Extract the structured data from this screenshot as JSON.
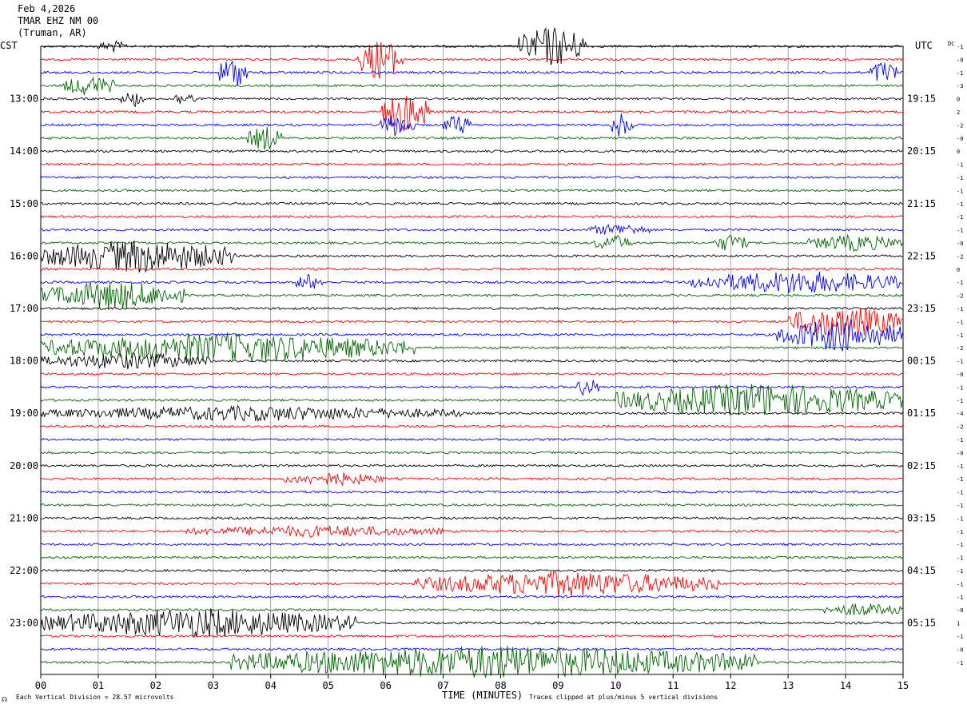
{
  "header": {
    "date": "Feb 4,2026",
    "station": "TMAR EHZ NM 00",
    "location": "(Truman, AR)"
  },
  "axis_labels": {
    "left_tz": "CST",
    "right_tz": "UTC",
    "dc_label": "DC",
    "xlabel": "TIME (MINUTES)"
  },
  "footer": {
    "mark": "☊",
    "scale": "Each Vertical Division =   28.57 microvolts",
    "clip": "Traces clipped at plus/minus 5 vertical divisions"
  },
  "colors": {
    "black": "#000000",
    "red": "#ff0000",
    "blue": "#0000ff",
    "green": "#006400",
    "grid": "#808080"
  },
  "chart_data": {
    "type": "line",
    "title": "TMAR EHZ NM 00 (Truman, AR)",
    "xlabel": "TIME (MINUTES)",
    "xlim": [
      0,
      15
    ],
    "x_ticks": [
      "00",
      "01",
      "02",
      "03",
      "04",
      "05",
      "06",
      "07",
      "08",
      "09",
      "10",
      "11",
      "12",
      "13",
      "14",
      "15"
    ],
    "left_hour_labels": [
      "13:00",
      "14:00",
      "15:00",
      "16:00",
      "17:00",
      "18:00",
      "19:00",
      "20:00",
      "21:00",
      "22:00",
      "23:00"
    ],
    "right_hour_labels": [
      "19:15",
      "20:15",
      "21:15",
      "22:15",
      "23:15",
      "00:15",
      "01:15",
      "02:15",
      "03:15",
      "04:15",
      "05:15"
    ],
    "trace_colors": [
      "black",
      "red",
      "blue",
      "green"
    ],
    "dc_offsets": [
      "-1",
      "-0",
      "-1",
      "-3",
      "0",
      "2",
      "-2",
      "-0",
      "0",
      "-1",
      "-1",
      "-1",
      "-1",
      "-1",
      "-1",
      "-0",
      "-2",
      "0",
      "-1",
      "-2",
      "-1",
      "-1",
      "-1",
      "-2",
      "-1",
      "-0",
      "-1",
      "-1",
      "-4",
      "-2",
      "-1",
      "-0",
      "-1",
      "-1",
      "-1",
      "-1",
      "-1",
      "-1",
      "-1",
      "-1",
      "-1",
      "-1",
      "-1",
      "-0",
      "1",
      "-1",
      "-0",
      "-1"
    ],
    "activity_bursts": [
      {
        "row": 0,
        "start": 8.3,
        "end": 9.5,
        "level": 5
      },
      {
        "row": 0,
        "start": 1.0,
        "end": 1.5,
        "level": 1.5
      },
      {
        "row": 1,
        "start": 5.5,
        "end": 6.3,
        "level": 5
      },
      {
        "row": 2,
        "start": 3.1,
        "end": 3.6,
        "level": 4
      },
      {
        "row": 2,
        "start": 14.4,
        "end": 14.9,
        "level": 3
      },
      {
        "row": 3,
        "start": 0.4,
        "end": 1.3,
        "level": 2.5
      },
      {
        "row": 4,
        "start": 1.4,
        "end": 1.8,
        "level": 2
      },
      {
        "row": 4,
        "start": 2.3,
        "end": 2.7,
        "level": 1.8
      },
      {
        "row": 5,
        "start": 5.9,
        "end": 6.8,
        "level": 5
      },
      {
        "row": 6,
        "start": 5.9,
        "end": 6.5,
        "level": 3
      },
      {
        "row": 6,
        "start": 7.0,
        "end": 7.5,
        "level": 2.5
      },
      {
        "row": 6,
        "start": 9.9,
        "end": 10.3,
        "level": 3
      },
      {
        "row": 7,
        "start": 3.6,
        "end": 4.2,
        "level": 3
      },
      {
        "row": 14,
        "start": 9.5,
        "end": 10.6,
        "level": 1.5
      },
      {
        "row": 15,
        "start": 9.6,
        "end": 10.3,
        "level": 2
      },
      {
        "row": 15,
        "start": 11.7,
        "end": 12.3,
        "level": 2.2
      },
      {
        "row": 15,
        "start": 13.3,
        "end": 15.0,
        "level": 2
      },
      {
        "row": 16,
        "start": 0.0,
        "end": 3.4,
        "level": 4
      },
      {
        "row": 18,
        "start": 4.4,
        "end": 4.9,
        "level": 2
      },
      {
        "row": 18,
        "start": 11.3,
        "end": 15.0,
        "level": 2.8
      },
      {
        "row": 19,
        "start": 0.0,
        "end": 2.5,
        "level": 3.5
      },
      {
        "row": 21,
        "start": 13.0,
        "end": 15.0,
        "level": 4
      },
      {
        "row": 22,
        "start": 12.8,
        "end": 15.0,
        "level": 4
      },
      {
        "row": 23,
        "start": 0.0,
        "end": 6.5,
        "level": 3.5
      },
      {
        "row": 24,
        "start": 0.0,
        "end": 3.0,
        "level": 2
      },
      {
        "row": 26,
        "start": 9.3,
        "end": 9.7,
        "level": 2.5
      },
      {
        "row": 27,
        "start": 10.0,
        "end": 15.0,
        "level": 4
      },
      {
        "row": 28,
        "start": 0.0,
        "end": 7.3,
        "level": 1.8
      },
      {
        "row": 33,
        "start": 4.2,
        "end": 6.0,
        "level": 1.6
      },
      {
        "row": 37,
        "start": 2.5,
        "end": 7.0,
        "level": 1.4
      },
      {
        "row": 41,
        "start": 6.5,
        "end": 11.8,
        "level": 3
      },
      {
        "row": 43,
        "start": 13.6,
        "end": 15.0,
        "level": 1.6
      },
      {
        "row": 44,
        "start": 0.0,
        "end": 5.5,
        "level": 3.5
      },
      {
        "row": 47,
        "start": 3.3,
        "end": 12.5,
        "level": 4
      }
    ]
  }
}
